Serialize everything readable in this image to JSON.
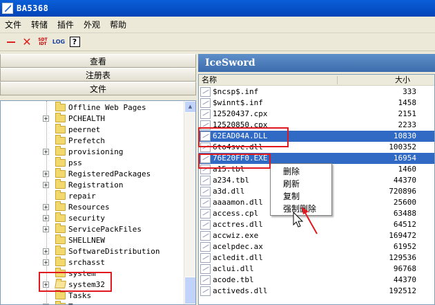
{
  "window": {
    "title": "BA5368"
  },
  "menu": {
    "items": [
      "文件",
      "转储",
      "插件",
      "外观",
      "帮助"
    ]
  },
  "toolbar": {
    "sdt_line1": "SDT",
    "sdt_line2": "IDT",
    "log_label": "LOG",
    "help_label": "?"
  },
  "left_panel": {
    "tabs": [
      "查看",
      "注册表",
      "文件"
    ],
    "tree": [
      {
        "label": "Offline Web Pages",
        "expandable": false
      },
      {
        "label": "PCHEALTH",
        "expandable": true
      },
      {
        "label": "peernet",
        "expandable": false
      },
      {
        "label": "Prefetch",
        "expandable": false
      },
      {
        "label": "provisioning",
        "expandable": true
      },
      {
        "label": "pss",
        "expandable": false
      },
      {
        "label": "RegisteredPackages",
        "expandable": true
      },
      {
        "label": "Registration",
        "expandable": true
      },
      {
        "label": "repair",
        "expandable": false
      },
      {
        "label": "Resources",
        "expandable": true
      },
      {
        "label": "security",
        "expandable": true
      },
      {
        "label": "ServicePackFiles",
        "expandable": true
      },
      {
        "label": "SHELLNEW",
        "expandable": false
      },
      {
        "label": "SoftwareDistribution",
        "expandable": true
      },
      {
        "label": "srchasst",
        "expandable": true
      },
      {
        "label": "system",
        "expandable": false
      },
      {
        "label": "system32",
        "expandable": true,
        "open": true
      },
      {
        "label": "Tasks",
        "expandable": false
      },
      {
        "label": "T",
        "expandable": true
      }
    ]
  },
  "right_panel": {
    "header": "IceSword",
    "columns": {
      "name": "名称",
      "size": "大小"
    },
    "files": [
      {
        "name": "$ncsp$.inf",
        "size": "333",
        "selected": false
      },
      {
        "name": "$winnt$.inf",
        "size": "1458",
        "selected": false
      },
      {
        "name": "12520437.cpx",
        "size": "2151",
        "selected": false
      },
      {
        "name": "12520850.cpx",
        "size": "2233",
        "selected": false
      },
      {
        "name": "62EAD04A.DLL",
        "size": "10830",
        "selected": true
      },
      {
        "name": "6to4svc.dll",
        "size": "100352",
        "selected": false
      },
      {
        "name": "76E20FF0.EXE",
        "size": "16954",
        "selected": true
      },
      {
        "name": "a15.tbl",
        "size": "1460",
        "selected": false
      },
      {
        "name": "a234.tbl",
        "size": "44370",
        "selected": false
      },
      {
        "name": "a3d.dll",
        "size": "720896",
        "selected": false
      },
      {
        "name": "aaaamon.dll",
        "size": "25600",
        "selected": false
      },
      {
        "name": "access.cpl",
        "size": "63488",
        "selected": false
      },
      {
        "name": "acctres.dll",
        "size": "64512",
        "selected": false
      },
      {
        "name": "accwiz.exe",
        "size": "169472",
        "selected": false
      },
      {
        "name": "acelpdec.ax",
        "size": "61952",
        "selected": false
      },
      {
        "name": "acledit.dll",
        "size": "129536",
        "selected": false
      },
      {
        "name": "aclui.dll",
        "size": "96768",
        "selected": false
      },
      {
        "name": "acode.tbl",
        "size": "44370",
        "selected": false
      },
      {
        "name": "activeds.dll",
        "size": "192512",
        "selected": false
      }
    ]
  },
  "context_menu": {
    "items": [
      "删除",
      "刷新",
      "复制",
      "强制删除"
    ]
  },
  "colors": {
    "highlight": "#e0191f",
    "selection": "#316ac5"
  }
}
